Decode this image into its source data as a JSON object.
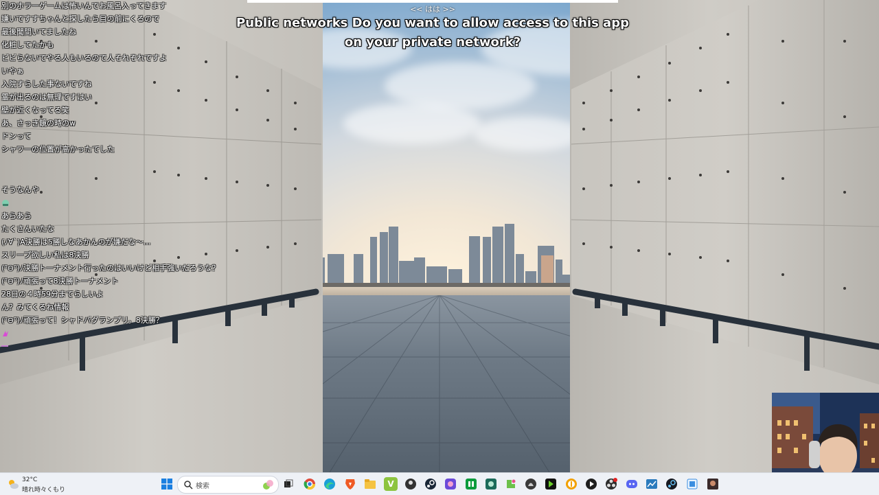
{
  "notification": {
    "nav": "<< はは >>",
    "caption": "Public networks Do you want to allow access to this app on your private network?"
  },
  "chat": {
    "messages": [
      "別のホラーゲームは怖いんでお風呂入ってきます",
      "嫌いですすちゃんと探したら目の前にくるので",
      "最後聞間いてましたね",
      "化粧してたかも",
      "ビビらないでやる人もいるので人それぞれですよ",
      "いやぁ",
      "入院すらした事ないですね",
      "霊が出るのは無理ですはい",
      "壁が近くなってる笑",
      "あ、さっき鏡の時のw",
      "ドンって",
      "シャワーの位置が高かったでした",
      "そうなんや",
      "あらあら",
      "たくさんいたな",
      "(ﾉ∀`)A決勝は5勝しなあかんのが嫌だな〜…",
      "スリープ欲しい私は8決勝",
      "(⁰⊖⁰)ﾉ決勝トーナメント行ったのはいいけど相手強いだろうな？",
      "(⁰⊖⁰)ﾉ頑張って8決勝トーナメント",
      "28日の４時59分までらしいよ",
      "ん？みてくるね情報",
      "(⁰⊖⁰)ﾉ頑張って！シャドバグランプリ。8決勝？"
    ]
  },
  "taskbar": {
    "weather": {
      "temp": "32°C",
      "desc": "晴れ時々くもり",
      "icon": "partly-sunny-icon"
    },
    "search_placeholder": "検索",
    "apps": [
      "start-icon",
      "task-view-icon",
      "chrome-icon",
      "edge-icon",
      "brave-icon",
      "file-explorer-icon",
      "vivaldi-icon",
      "app-icon",
      "steam-icon",
      "app-icon",
      "app-icon",
      "app-icon",
      "app-icon",
      "app-icon",
      "app-icon",
      "app-icon",
      "obs-icon",
      "discord-icon",
      "app-icon",
      "steam-icon",
      "app-icon",
      "app-icon"
    ]
  },
  "colors": {
    "taskbar_bg": "#eef1f6",
    "caption_text": "#ffffff",
    "chat_text": "#ffffff"
  }
}
